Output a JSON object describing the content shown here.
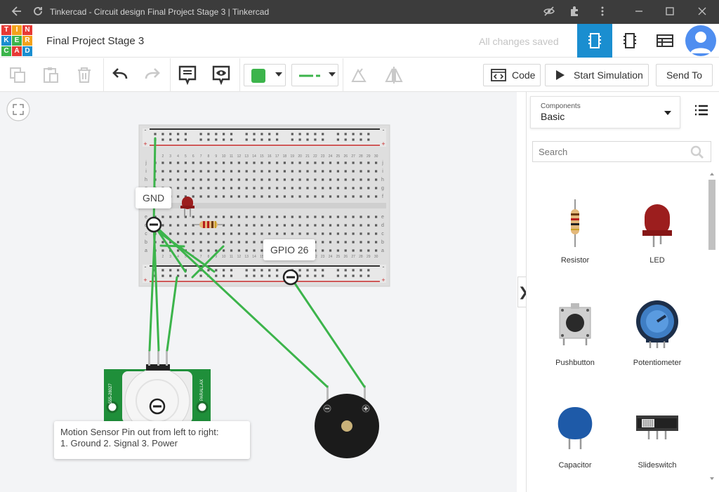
{
  "browser": {
    "title": "Tinkercad - Circuit design Final Project Stage 3 | Tinkercad"
  },
  "header": {
    "logo_letters": [
      "TIN",
      "KER",
      "CAD"
    ],
    "project_name": "Final Project Stage 3",
    "save_status": "All changes saved"
  },
  "toolbar": {
    "code_label": "Code",
    "start_simulation_label": "Start Simulation",
    "send_to_label": "Send To",
    "fill_color": "#3cb44b",
    "wire_color": "#3cb44b"
  },
  "canvas": {
    "gnd_label": "GND",
    "gpio_label": "GPIO 26",
    "note_line1": "Motion Sensor Pin out from left to right:",
    "note_line2": "1. Ground 2. Signal 3. Power",
    "sensor_side_left": "555-28027",
    "sensor_side_right": "PARALLAX",
    "breadboard_column_numbers": [
      "1",
      "2",
      "3",
      "4",
      "5",
      "6",
      "7",
      "8",
      "9",
      "10",
      "11",
      "12",
      "13",
      "14",
      "15",
      "16",
      "17",
      "18",
      "19",
      "20",
      "21",
      "22",
      "23",
      "24",
      "25",
      "26",
      "27",
      "28",
      "29",
      "30"
    ],
    "breadboard_row_letters_top": [
      "j",
      "i",
      "h",
      "g",
      "f"
    ],
    "breadboard_row_letters_bottom": [
      "e",
      "d",
      "c",
      "b",
      "a"
    ],
    "rail_minus": "-",
    "rail_plus": "+"
  },
  "panel": {
    "components_label": "Components",
    "components_value": "Basic",
    "search_placeholder": "Search",
    "items": [
      {
        "label": "Resistor"
      },
      {
        "label": "LED"
      },
      {
        "label": "Pushbutton"
      },
      {
        "label": "Potentiometer"
      },
      {
        "label": "Capacitor"
      },
      {
        "label": "Slideswitch"
      }
    ]
  },
  "colors": {
    "accent": "#1a8ed0",
    "wire": "#3cb44b",
    "pcb": "#1f8f3a",
    "led": "#9c1e1e"
  }
}
